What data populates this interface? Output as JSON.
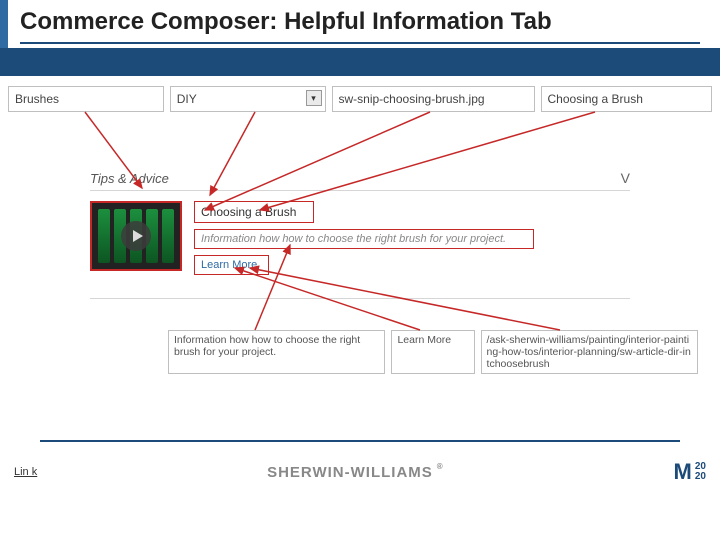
{
  "title": "Commerce Composer: Helpful Information Tab",
  "toprow": {
    "brushes": "Brushes",
    "diy": "DIY",
    "image_name": "sw-snip-choosing-brush.jpg",
    "item_title": "Choosing a Brush"
  },
  "tips_header": "Tips & Advice",
  "chevron": "V",
  "card": {
    "title": "Choosing a Brush",
    "desc": "Information how how to choose the right brush for your project.",
    "learn_more": "Learn More"
  },
  "bottom": {
    "desc": "Information how how to choose the right brush for your project.",
    "learn_more": "Learn More",
    "url": "/ask-sherwin-williams/painting/interior-painting-how-tos/interior-planning/sw-article-dir-intchoosebrush"
  },
  "footer": {
    "link_label": "Lin k",
    "brand1": "SHERWIN-WILLIAMS",
    "brand2_m": "M",
    "brand2_top": "20",
    "brand2_bot": "20"
  }
}
